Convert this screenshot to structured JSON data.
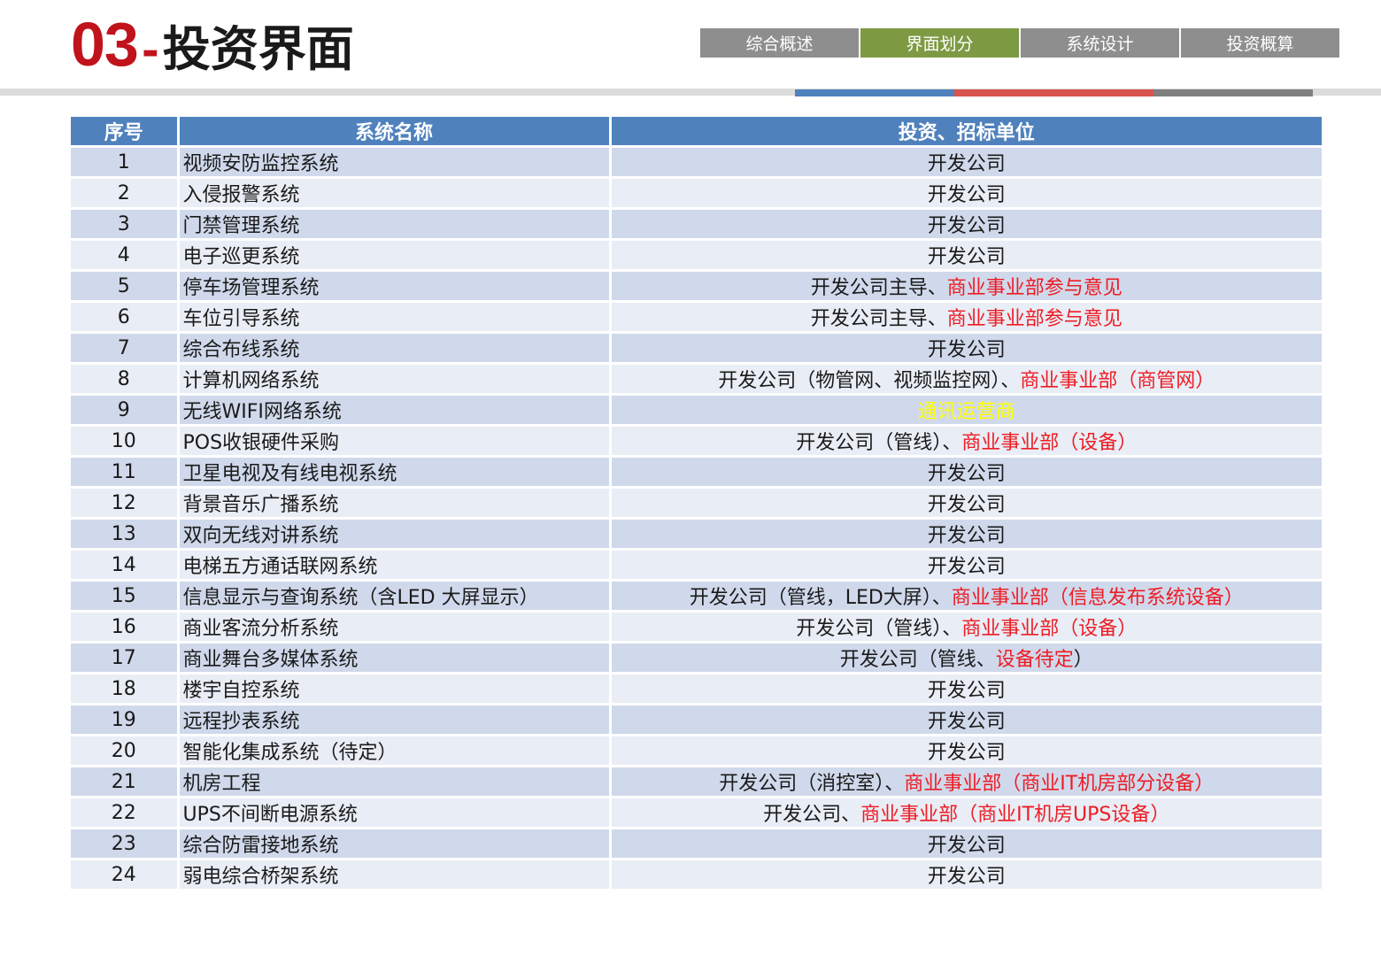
{
  "header": {
    "title_number": "03",
    "title_dash": "-",
    "title_text": "投资界面"
  },
  "nav": {
    "tabs": [
      {
        "label": "综合概述",
        "active": false
      },
      {
        "label": "界面划分",
        "active": true
      },
      {
        "label": "系统设计",
        "active": false
      },
      {
        "label": "投资概算",
        "active": false
      }
    ]
  },
  "colors": {
    "title_red": "#c0131b",
    "nav_gray": "#8e8e8e",
    "nav_active_green": "#7d9a43",
    "header_blue": "#4f81bd",
    "row_odd": "#d0d9eb",
    "row_even": "#e9edf5",
    "highlight_red": "#ee1c24",
    "highlight_yellow": "#ffff00",
    "accent_blue": "#4f81bd",
    "accent_red": "#d9534f",
    "accent_gray": "#7f7f7f"
  },
  "table": {
    "headers": [
      "序号",
      "系统名称",
      "投资、招标单位"
    ],
    "rows": [
      {
        "no": "1",
        "name": "视频安防监控系统",
        "unit": [
          {
            "t": "开发公司",
            "c": ""
          }
        ]
      },
      {
        "no": "2",
        "name": "入侵报警系统",
        "unit": [
          {
            "t": "开发公司",
            "c": ""
          }
        ]
      },
      {
        "no": "3",
        "name": "门禁管理系统",
        "unit": [
          {
            "t": "开发公司",
            "c": ""
          }
        ]
      },
      {
        "no": "4",
        "name": "电子巡更系统",
        "unit": [
          {
            "t": "开发公司",
            "c": ""
          }
        ]
      },
      {
        "no": "5",
        "name": "停车场管理系统",
        "unit": [
          {
            "t": "开发公司主导、",
            "c": ""
          },
          {
            "t": "商业事业部参与意见",
            "c": "red"
          }
        ]
      },
      {
        "no": "6",
        "name": "车位引导系统",
        "unit": [
          {
            "t": "开发公司主导、",
            "c": ""
          },
          {
            "t": "商业事业部参与意见",
            "c": "red"
          }
        ]
      },
      {
        "no": "7",
        "name": "综合布线系统",
        "unit": [
          {
            "t": "开发公司",
            "c": ""
          }
        ]
      },
      {
        "no": "8",
        "name": "计算机网络系统",
        "unit": [
          {
            "t": "开发公司（物管网、视频监控网）、",
            "c": ""
          },
          {
            "t": "商业事业部（商管网）",
            "c": "red"
          }
        ]
      },
      {
        "no": "9",
        "name": "无线WIFI网络系统",
        "unit": [
          {
            "t": "通讯运营商",
            "c": "yel"
          }
        ]
      },
      {
        "no": "10",
        "name": "POS收银硬件采购",
        "unit": [
          {
            "t": "开发公司（管线）、",
            "c": ""
          },
          {
            "t": "商业事业部（设备）",
            "c": "red"
          }
        ]
      },
      {
        "no": "11",
        "name": "卫星电视及有线电视系统",
        "unit": [
          {
            "t": "开发公司",
            "c": ""
          }
        ]
      },
      {
        "no": "12",
        "name": "背景音乐广播系统",
        "unit": [
          {
            "t": "开发公司",
            "c": ""
          }
        ]
      },
      {
        "no": "13",
        "name": "双向无线对讲系统",
        "unit": [
          {
            "t": "开发公司",
            "c": ""
          }
        ]
      },
      {
        "no": "14",
        "name": "电梯五方通话联网系统",
        "unit": [
          {
            "t": "开发公司",
            "c": ""
          }
        ]
      },
      {
        "no": "15",
        "name": "信息显示与查询系统（含LED 大屏显示）",
        "unit": [
          {
            "t": "开发公司（管线，LED大屏）、",
            "c": ""
          },
          {
            "t": "商业事业部（信息发布系统设备）",
            "c": "red"
          }
        ]
      },
      {
        "no": "16",
        "name": "商业客流分析系统",
        "unit": [
          {
            "t": "开发公司（管线）、",
            "c": ""
          },
          {
            "t": "商业事业部（设备）",
            "c": "red"
          }
        ]
      },
      {
        "no": "17",
        "name": "商业舞台多媒体系统",
        "unit": [
          {
            "t": "开发公司（管线、",
            "c": ""
          },
          {
            "t": "设备待定",
            "c": "red"
          },
          {
            "t": "）",
            "c": ""
          }
        ]
      },
      {
        "no": "18",
        "name": "楼宇自控系统",
        "unit": [
          {
            "t": "开发公司",
            "c": ""
          }
        ]
      },
      {
        "no": "19",
        "name": "远程抄表系统",
        "unit": [
          {
            "t": "开发公司",
            "c": ""
          }
        ]
      },
      {
        "no": "20",
        "name": "智能化集成系统（待定）",
        "unit": [
          {
            "t": "开发公司",
            "c": ""
          }
        ]
      },
      {
        "no": "21",
        "name": "机房工程",
        "unit": [
          {
            "t": "开发公司（消控室）、",
            "c": ""
          },
          {
            "t": "商业事业部（商业IT机房部分设备）",
            "c": "red"
          }
        ]
      },
      {
        "no": "22",
        "name": "UPS不间断电源系统",
        "unit": [
          {
            "t": "开发公司、",
            "c": ""
          },
          {
            "t": "商业事业部（商业IT机房UPS设备）",
            "c": "red"
          }
        ]
      },
      {
        "no": "23",
        "name": "综合防雷接地系统",
        "unit": [
          {
            "t": "开发公司",
            "c": ""
          }
        ]
      },
      {
        "no": "24",
        "name": "弱电综合桥架系统",
        "unit": [
          {
            "t": "开发公司",
            "c": ""
          }
        ]
      }
    ]
  }
}
